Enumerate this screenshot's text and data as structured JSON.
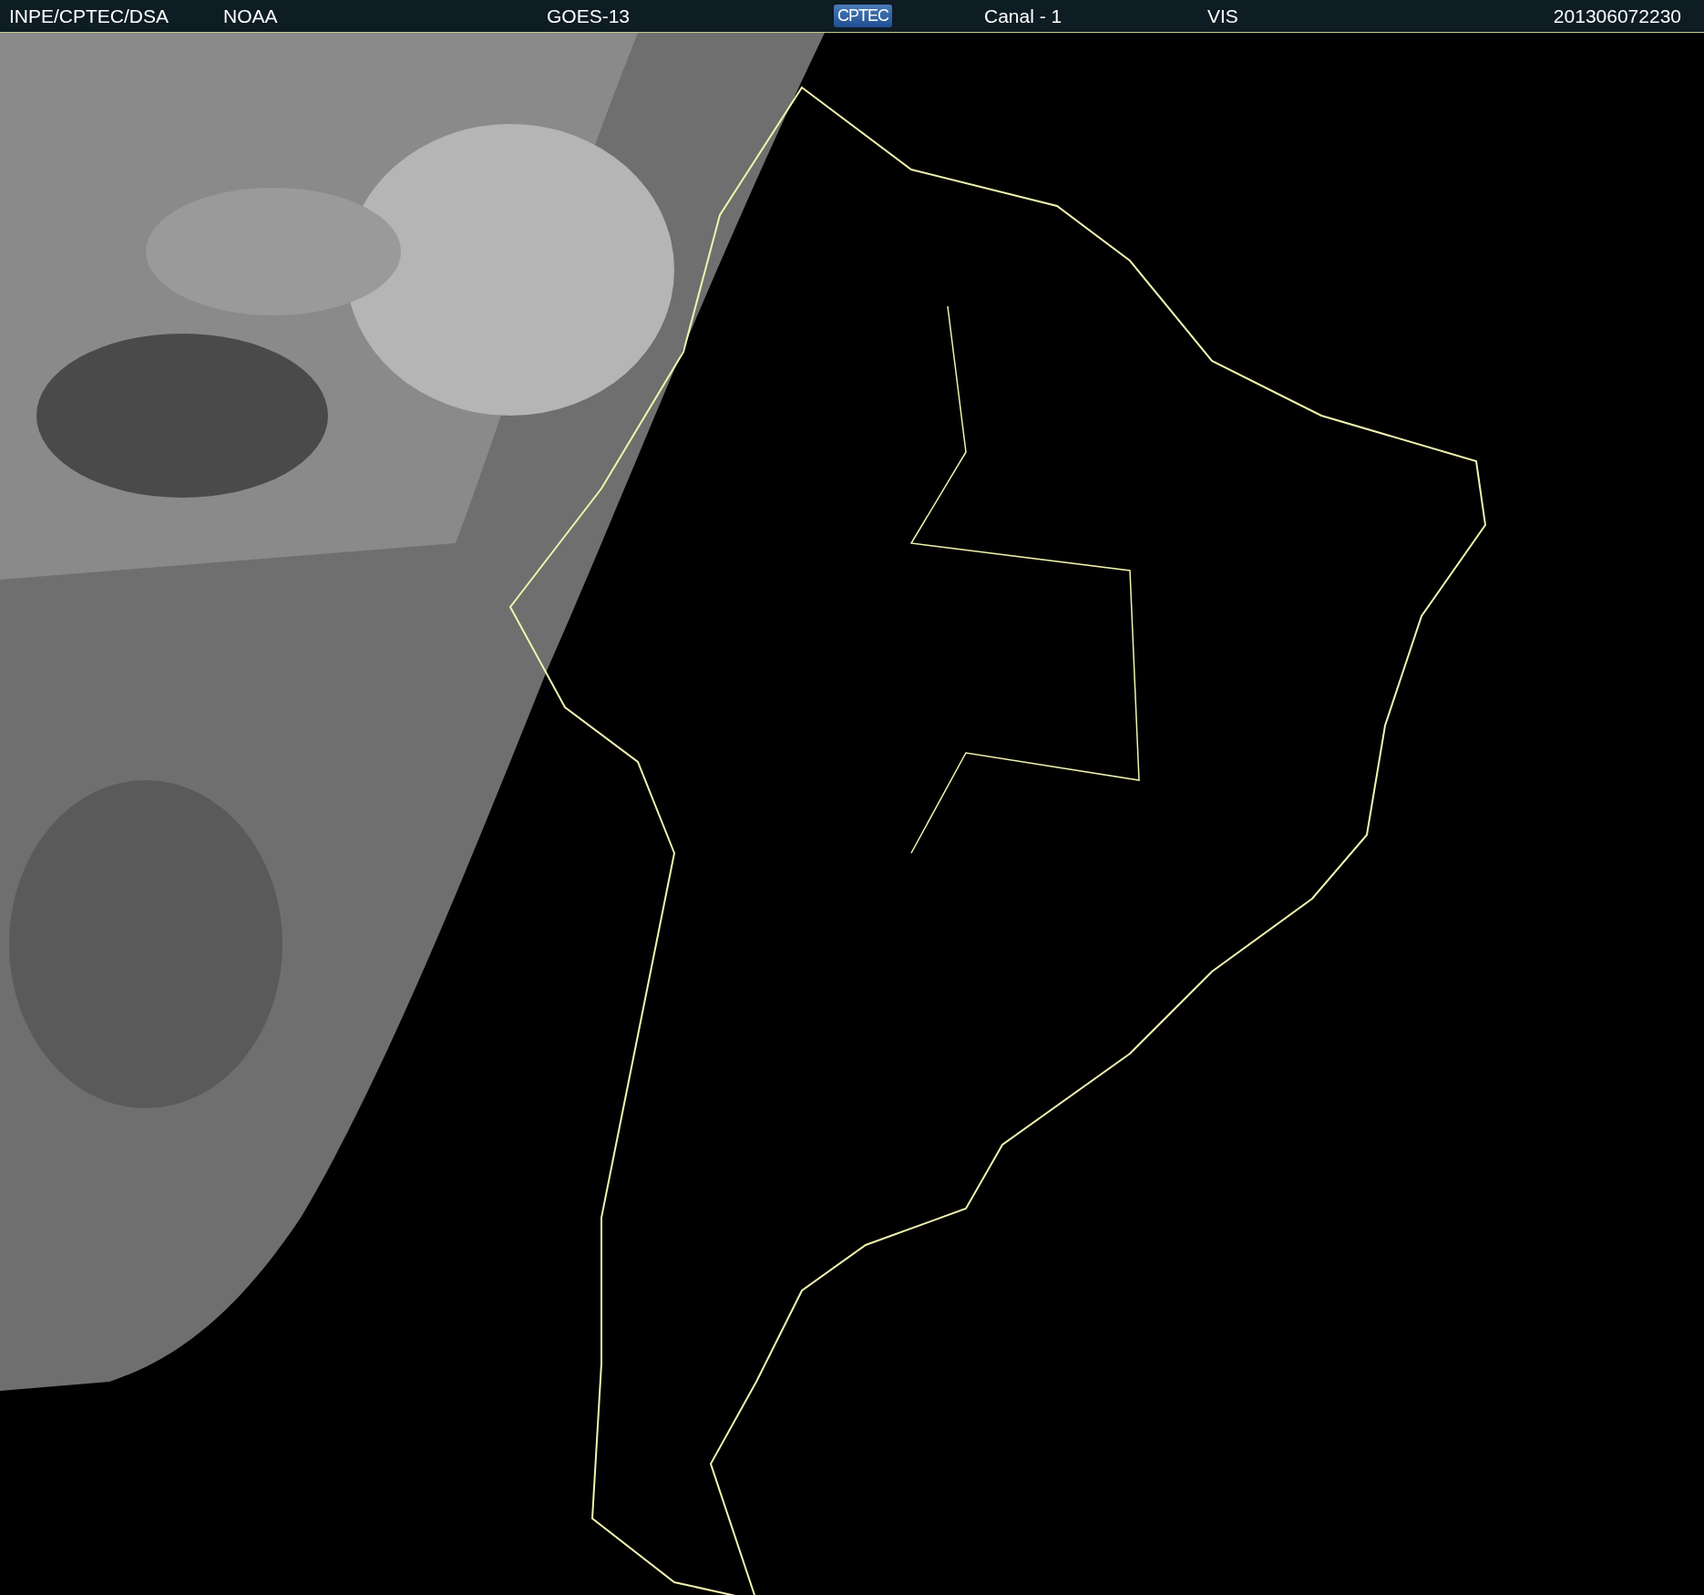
{
  "header": {
    "items": [
      {
        "kind": "text",
        "text": "INPE/CPTEC/DSA"
      },
      {
        "kind": "text",
        "text": "NOAA"
      },
      {
        "kind": "text",
        "text": "GOES-13"
      },
      {
        "kind": "logo",
        "text": "CPTEC"
      },
      {
        "kind": "text",
        "text": "Canal - 1"
      },
      {
        "kind": "text",
        "text": "VIS"
      },
      {
        "kind": "text",
        "text": "201306072230"
      }
    ]
  }
}
